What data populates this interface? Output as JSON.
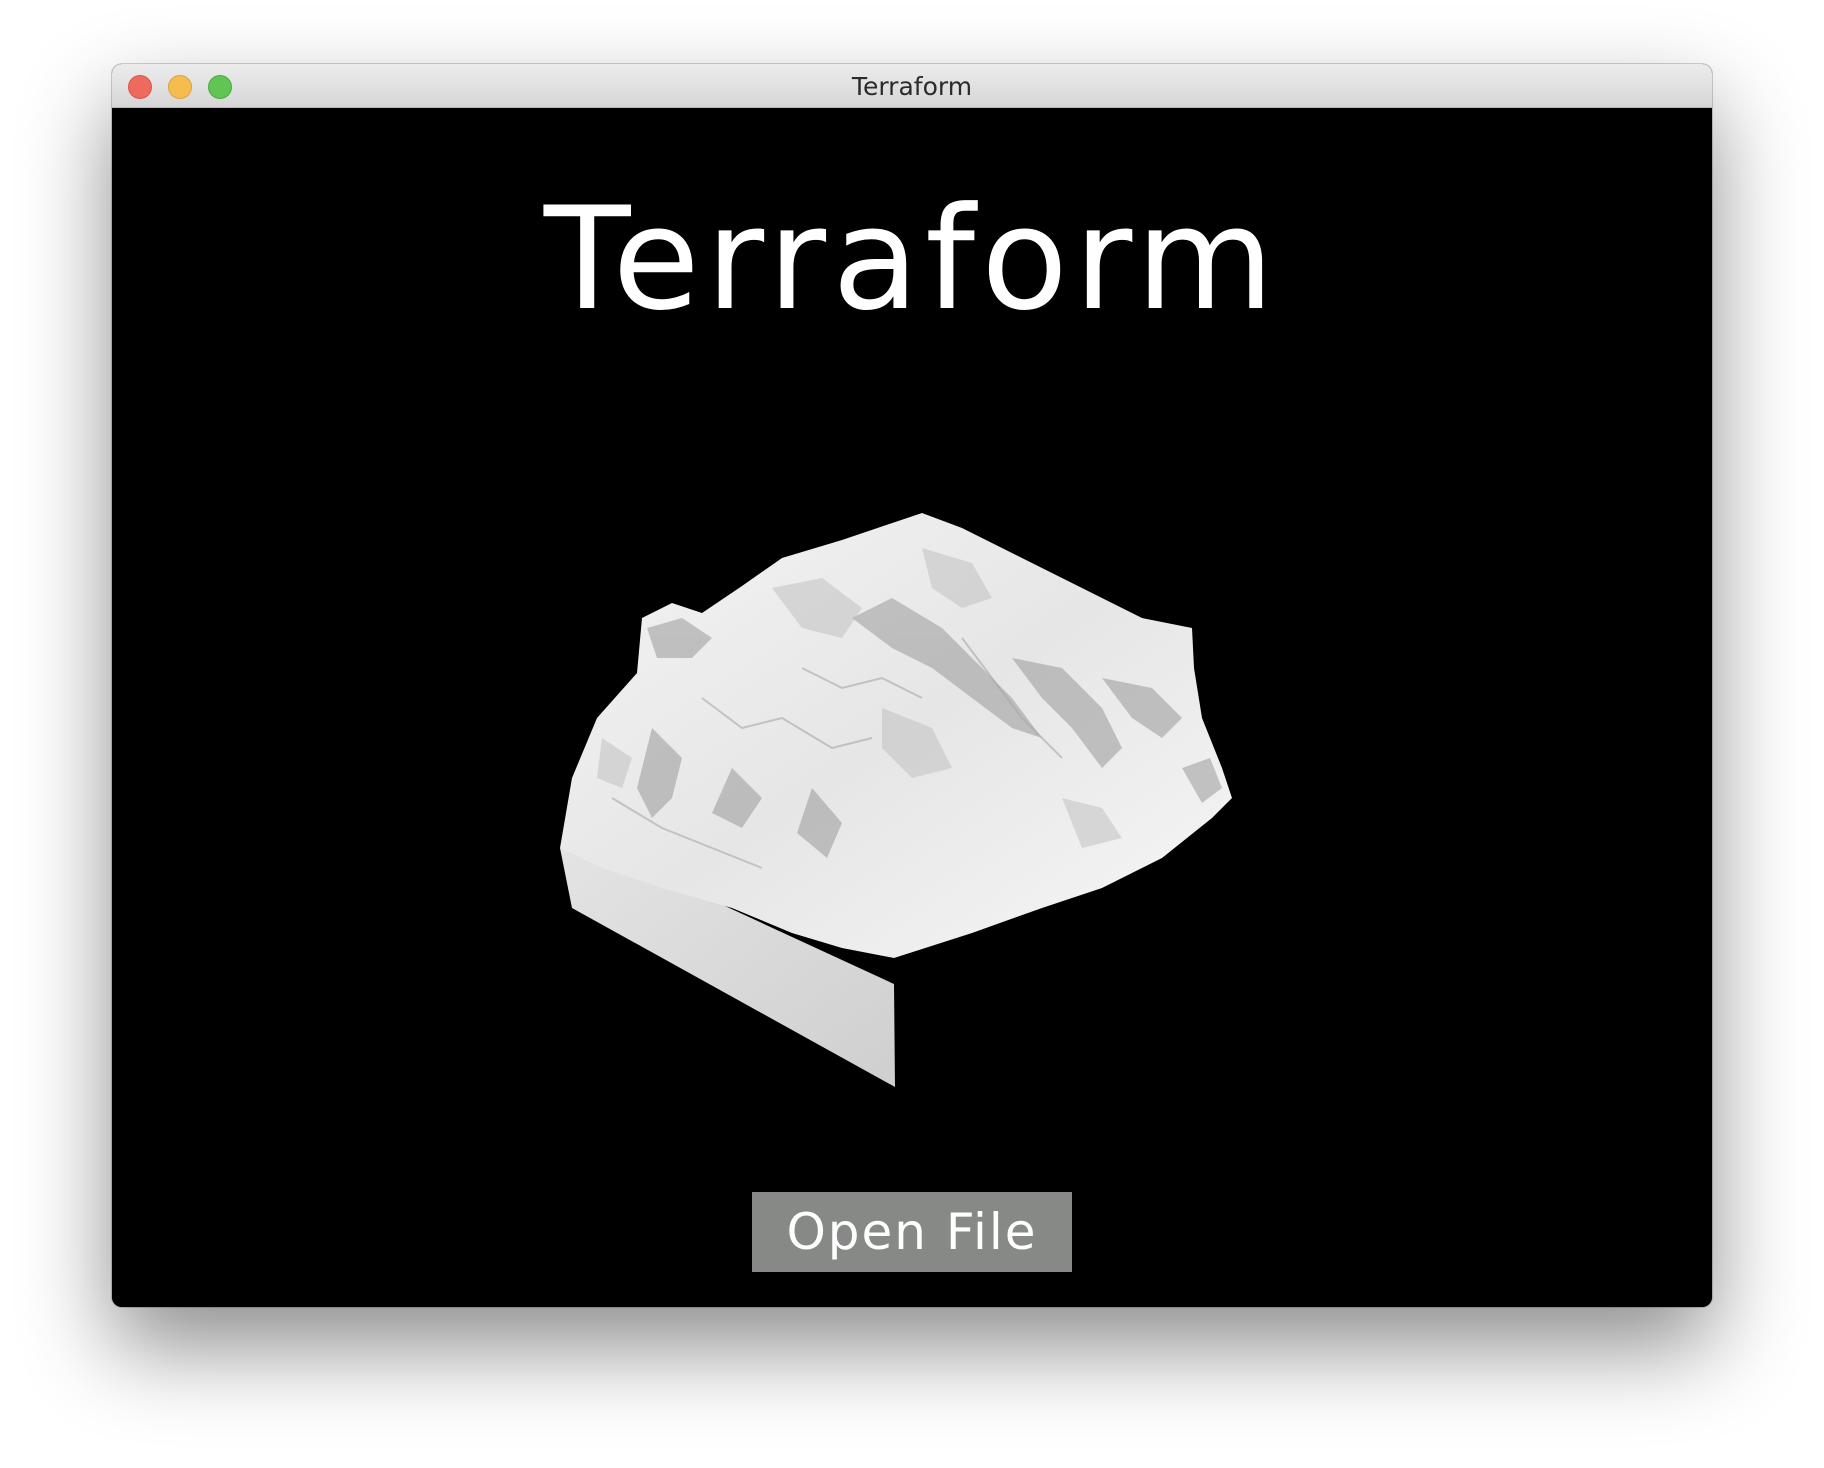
{
  "window": {
    "title": "Terraform",
    "controls": [
      "close",
      "minimize",
      "zoom"
    ]
  },
  "main": {
    "title": "Terraform",
    "preview_icon": "terrain-model",
    "open_button_label": "Open File"
  },
  "colors": {
    "background": "#000000",
    "title_text": "#ffffff",
    "button_background": "#868985",
    "button_text": "#ffffff"
  }
}
